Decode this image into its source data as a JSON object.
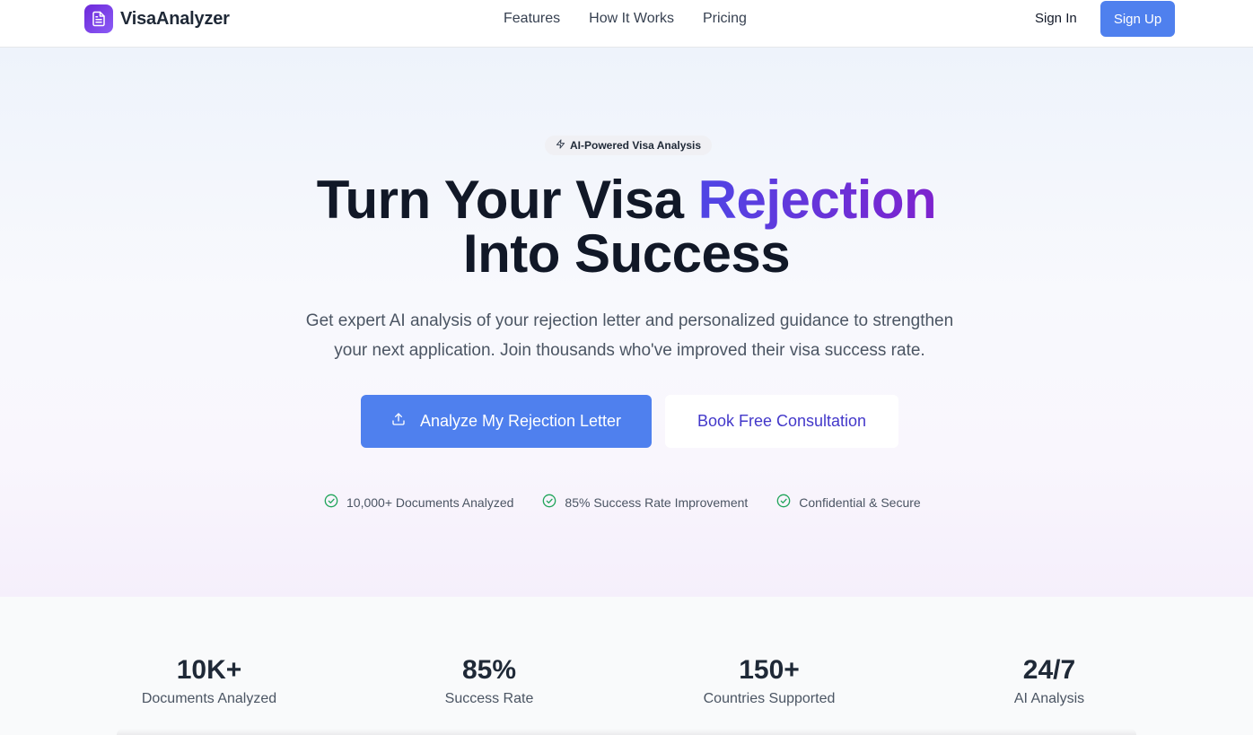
{
  "header": {
    "brand": "VisaAnalyzer",
    "logo_icon": "document-icon",
    "nav": [
      "Features",
      "How It Works",
      "Pricing"
    ],
    "sign_in": "Sign In",
    "sign_up": "Sign Up"
  },
  "hero": {
    "badge": "AI-Powered Visa Analysis",
    "badge_icon": "lightning-icon",
    "title_part1": "Turn Your Visa ",
    "title_accent": "Rejection",
    "title_part2": "Into Success",
    "subtitle_line1": "Get expert AI analysis of your rejection letter and personalized guidance to strengthen",
    "subtitle_line2": "your next application. Join thousands who've improved their visa success rate.",
    "cta_primary": "Analyze My Rejection Letter",
    "cta_primary_icon": "upload-icon",
    "cta_secondary": "Book Free Consultation",
    "trust": [
      "10,000+ Documents Analyzed",
      "85% Success Rate Improvement",
      "Confidential & Secure"
    ],
    "trust_icon": "check-circle-icon"
  },
  "stats": [
    {
      "value": "10K+",
      "label": "Documents Analyzed"
    },
    {
      "value": "85%",
      "label": "Success Rate"
    },
    {
      "value": "150+",
      "label": "Countries Supported"
    },
    {
      "value": "24/7",
      "label": "AI Analysis"
    }
  ],
  "colors": {
    "primary": "#4f80ee",
    "accent_start": "#4f46e5",
    "accent_end": "#7e22ce",
    "check": "#22a55b"
  }
}
